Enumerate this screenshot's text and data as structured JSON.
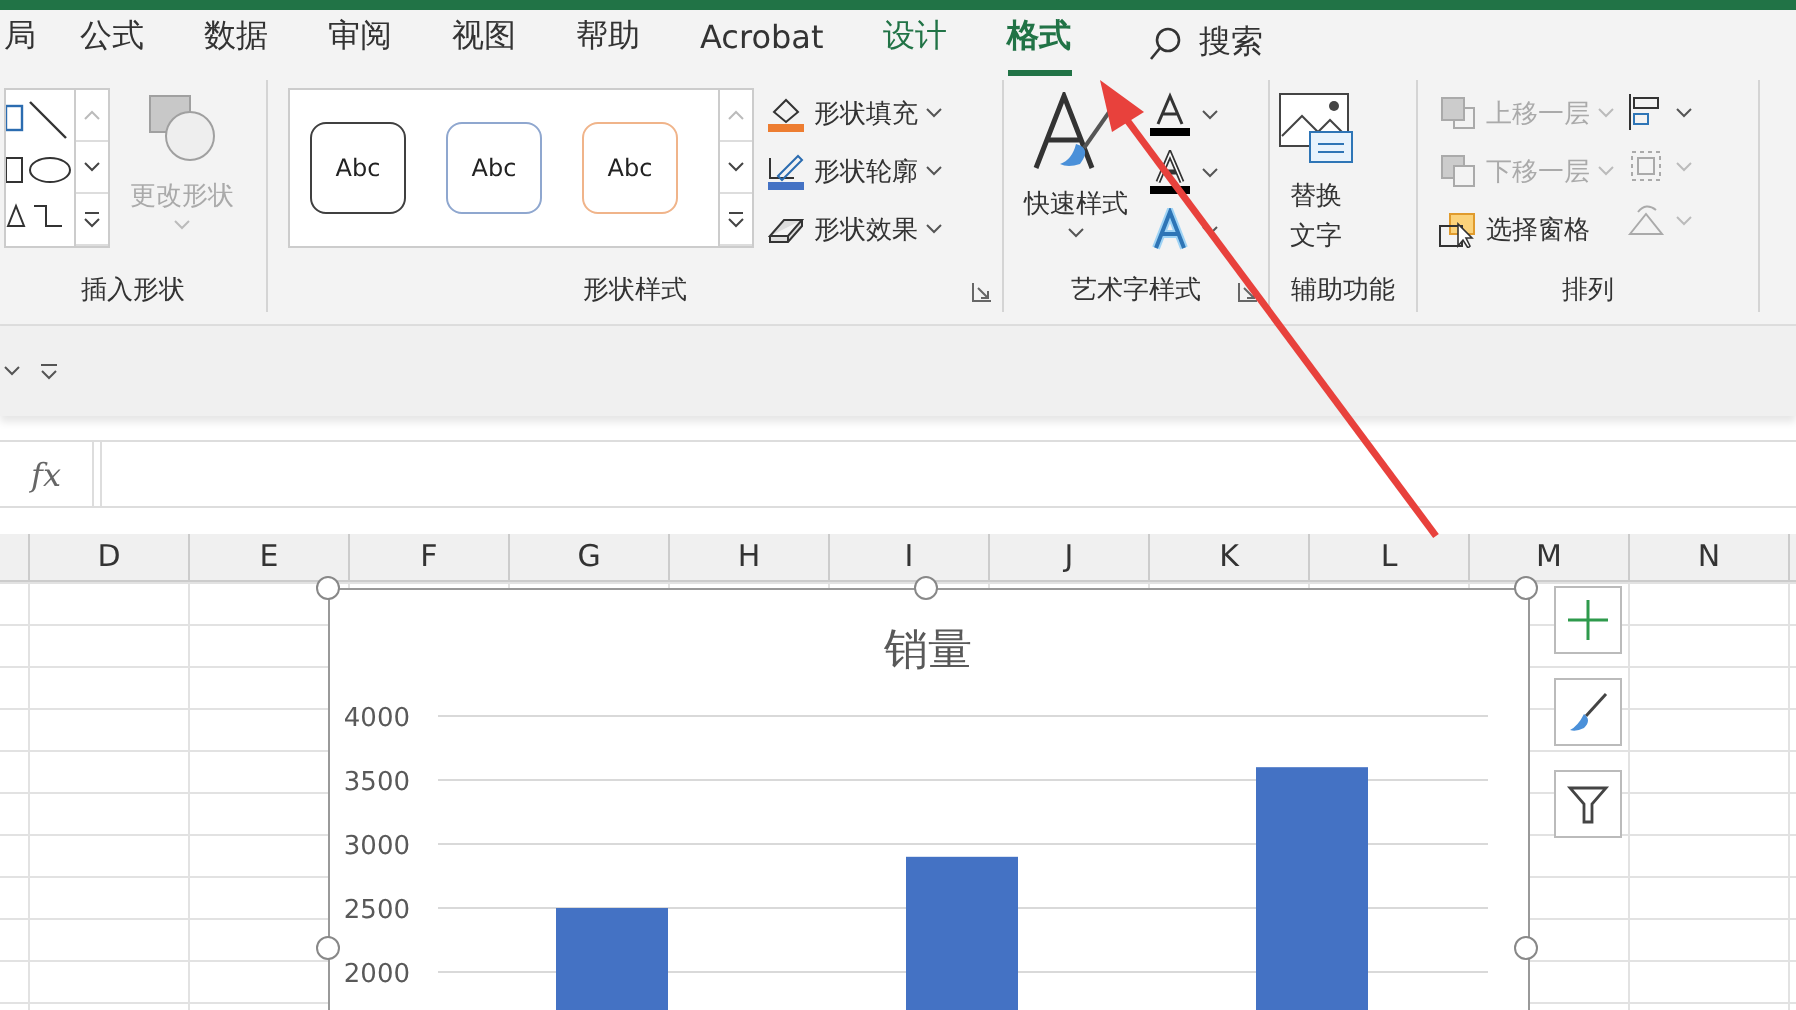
{
  "tabs": [
    {
      "label": "局",
      "kind": "standard",
      "selected": false
    },
    {
      "label": "公式",
      "kind": "standard",
      "selected": false
    },
    {
      "label": "数据",
      "kind": "standard",
      "selected": false
    },
    {
      "label": "审阅",
      "kind": "standard",
      "selected": false
    },
    {
      "label": "视图",
      "kind": "standard",
      "selected": false
    },
    {
      "label": "帮助",
      "kind": "standard",
      "selected": false
    },
    {
      "label": "Acrobat",
      "kind": "standard",
      "selected": false
    },
    {
      "label": "设计",
      "kind": "contextual",
      "selected": false
    },
    {
      "label": "格式",
      "kind": "contextual",
      "selected": true
    }
  ],
  "search": {
    "label": "搜索"
  },
  "ribbon": {
    "insert_shapes": {
      "change_shape": {
        "label": "更改形状",
        "disabled": true
      },
      "label": "插入形状"
    },
    "shape_styles": {
      "swatches": [
        {
          "text": "Abc",
          "color": "#404040"
        },
        {
          "text": "Abc",
          "color": "#8fa7cf"
        },
        {
          "text": "Abc",
          "color": "#f0b48a"
        }
      ],
      "commands": [
        {
          "label": "形状填充",
          "kind": "fill"
        },
        {
          "label": "形状轮廓",
          "kind": "outline"
        },
        {
          "label": "形状效果",
          "kind": "effects"
        }
      ],
      "label": "形状样式"
    },
    "wordart_styles": {
      "quick_styles": "快速样式",
      "label": "艺术字样式"
    },
    "accessibility": {
      "alt_text": "替换文字",
      "label": "辅助功能"
    },
    "arrange": {
      "commands": [
        {
          "label": "上移一层",
          "kind": "forward",
          "disabled": true
        },
        {
          "label": "下移一层",
          "kind": "backward",
          "disabled": true
        },
        {
          "label": "选择窗格",
          "kind": "pane",
          "disabled": false
        }
      ],
      "tools": [
        {
          "kind": "align",
          "disabled": false
        },
        {
          "kind": "group",
          "disabled": true
        },
        {
          "kind": "rotate",
          "disabled": true
        }
      ],
      "label": "排列"
    }
  },
  "formula_bar": {
    "fx": "fx"
  },
  "columns": [
    "D",
    "E",
    "F",
    "G",
    "H",
    "I",
    "J",
    "K",
    "L",
    "M",
    "N"
  ],
  "chart": {
    "chart_data": {
      "type": "bar",
      "title": "销量",
      "values": [
        2500,
        2900,
        3600
      ],
      "ylim": [
        1600,
        4000
      ],
      "yticks": [
        2000,
        2500,
        3000,
        3500,
        4000
      ],
      "grid": true
    }
  }
}
